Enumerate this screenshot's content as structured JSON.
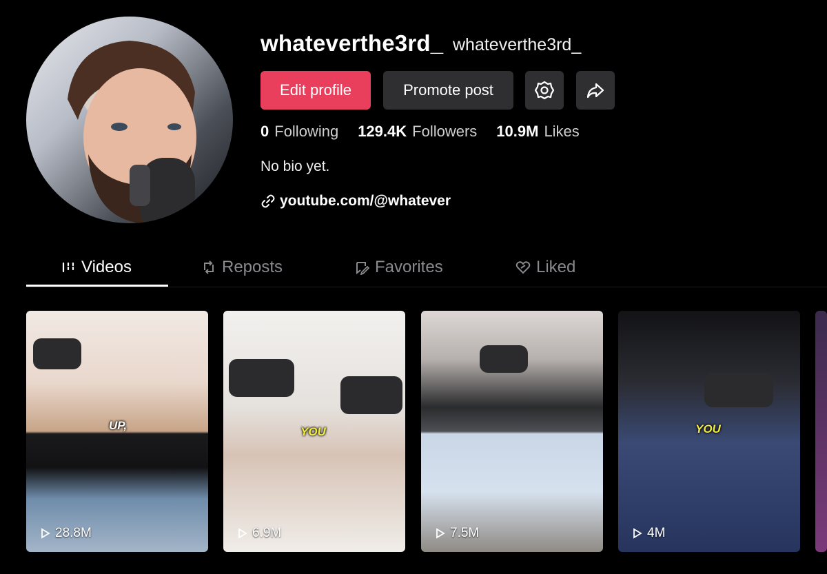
{
  "profile": {
    "username": "whateverthe3rd_",
    "nickname": "whateverthe3rd_",
    "bio": "No bio yet.",
    "link": "youtube.com/@whatever"
  },
  "actions": {
    "edit_profile": "Edit profile",
    "promote_post": "Promote post",
    "settings_icon": "gear-icon",
    "share_icon": "share-icon"
  },
  "stats": {
    "following_count": "0",
    "following_label": "Following",
    "followers_count": "129.4K",
    "followers_label": "Followers",
    "likes_count": "10.9M",
    "likes_label": "Likes"
  },
  "tabs": [
    {
      "label": "Videos",
      "icon": "grid-icon",
      "active": true
    },
    {
      "label": "Reposts",
      "icon": "repost-icon",
      "active": false
    },
    {
      "label": "Favorites",
      "icon": "bookmark-icon",
      "active": false
    },
    {
      "label": "Liked",
      "icon": "heart-icon",
      "active": false
    }
  ],
  "videos": [
    {
      "views": "28.8M",
      "caption": "UP,"
    },
    {
      "views": "6.9M",
      "caption": "YOU"
    },
    {
      "views": "7.5M",
      "caption": ""
    },
    {
      "views": "4M",
      "caption": "YOU"
    }
  ],
  "colors": {
    "accent": "#ea3f5c",
    "button_bg": "#2f2f31",
    "background": "#000000"
  }
}
